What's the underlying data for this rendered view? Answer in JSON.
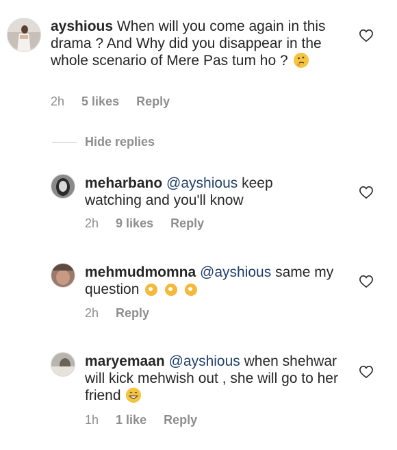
{
  "comments": [
    {
      "user": "ayshious",
      "text": "When will you come again in this drama ? And Why did you disappear in the whole scenario of Mere Pas tum ho ?",
      "time": "2h",
      "likes": "5 likes",
      "reply": "Reply",
      "emoji": "thinking-face"
    },
    {
      "user": "meharbano",
      "mention": "@ayshious",
      "text": "keep watching and you'll know",
      "time": "2h",
      "likes": "9 likes",
      "reply": "Reply"
    },
    {
      "user": "mehmudmomna",
      "mention": "@ayshious",
      "text": "same my question",
      "time": "2h",
      "reply": "Reply",
      "emoji": "ok-hand x3"
    },
    {
      "user": "maryemaan",
      "mention": "@ayshious",
      "text": "when shehwar will kick mehwish out , she will go to her friend",
      "time": "1h",
      "likes": "1 like",
      "reply": "Reply",
      "emoji": "grinning-face"
    }
  ],
  "hide_replies": "Hide replies",
  "colors": {
    "text": "#262626",
    "meta": "#8e8e8e",
    "mention": "#1f3f6b"
  },
  "icons": [
    "heart-outline-icon"
  ]
}
